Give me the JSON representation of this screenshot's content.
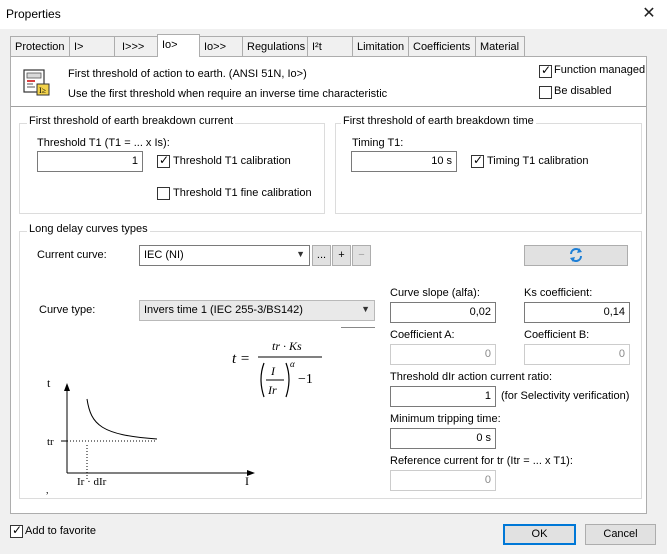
{
  "window": {
    "title": "Properties"
  },
  "tabs": [
    {
      "label": "Protection"
    },
    {
      "label": "I>"
    },
    {
      "label": "I>>>"
    },
    {
      "label": "Io>"
    },
    {
      "label": "Io>>"
    },
    {
      "label": "Regulations"
    },
    {
      "label": "I²t"
    },
    {
      "label": "Limitation"
    },
    {
      "label": "Coefficients"
    },
    {
      "label": "Material"
    }
  ],
  "header": {
    "description_line1": "First threshold of action to earth. (ANSI 51N, Io>)",
    "description_line2": "Use the first threshold when require an inverse time characteristic",
    "function_managed": {
      "label": "Function managed",
      "checked": true
    },
    "be_disabled": {
      "label": "Be disabled",
      "checked": false
    }
  },
  "current_group": {
    "title": "First threshold of earth breakdown current",
    "threshold_label": "Threshold T1 (T1 = ... x Is):",
    "threshold_value": "1",
    "calibration": {
      "label": "Threshold T1 calibration",
      "checked": true
    },
    "fine_calibration": {
      "label": "Threshold T1 fine calibration",
      "checked": false
    }
  },
  "time_group": {
    "title": "First threshold of earth breakdown time",
    "timing_label": "Timing T1:",
    "timing_value": "10 s",
    "calibration": {
      "label": "Timing T1 calibration",
      "checked": true
    }
  },
  "curves": {
    "title": "Long delay curves types",
    "current_curve_label": "Current curve:",
    "current_curve_value": "IEC (NI)",
    "ellipsis_button": "...",
    "add_button": "+",
    "remove_button": "−",
    "curve_type_label": "Curve type:",
    "curve_type_value": "Invers time 1 (IEC 255-3/BS142)",
    "formula": {
      "lhs": "t =",
      "numerator": "tr · Ks",
      "inner_numerator": "I",
      "inner_denominator": "Ir",
      "exponent": "α",
      "tail": "−1"
    },
    "graph": {
      "y_axis": "t",
      "x_axis": "I",
      "tr_label": "tr",
      "x_tick_label": "Ir · dIr",
      "corner_mark": ","
    },
    "fields": {
      "curve_slope": {
        "label": "Curve slope (alfa):",
        "value": "0,02"
      },
      "ks_coefficient": {
        "label": "Ks coefficient:",
        "value": "0,14"
      },
      "coefficient_a": {
        "label": "Coefficient A:",
        "value": "0"
      },
      "coefficient_b": {
        "label": "Coefficient B:",
        "value": "0"
      },
      "threshold_dir": {
        "label": "Threshold dIr action current ratio:",
        "value": "1",
        "note": "(for Selectivity verification)"
      },
      "min_tripping": {
        "label": "Minimum tripping time:",
        "value": "0 s"
      },
      "reference_current": {
        "label": "Reference current for tr (Itr = ... x T1):",
        "value": "0"
      }
    }
  },
  "footer": {
    "add_to_favorite": {
      "label": "Add to favorite",
      "checked": true
    },
    "ok": "OK",
    "cancel": "Cancel"
  },
  "colors": {
    "accent": "#0078d7",
    "refresh_icon": "#1e7fd6"
  }
}
